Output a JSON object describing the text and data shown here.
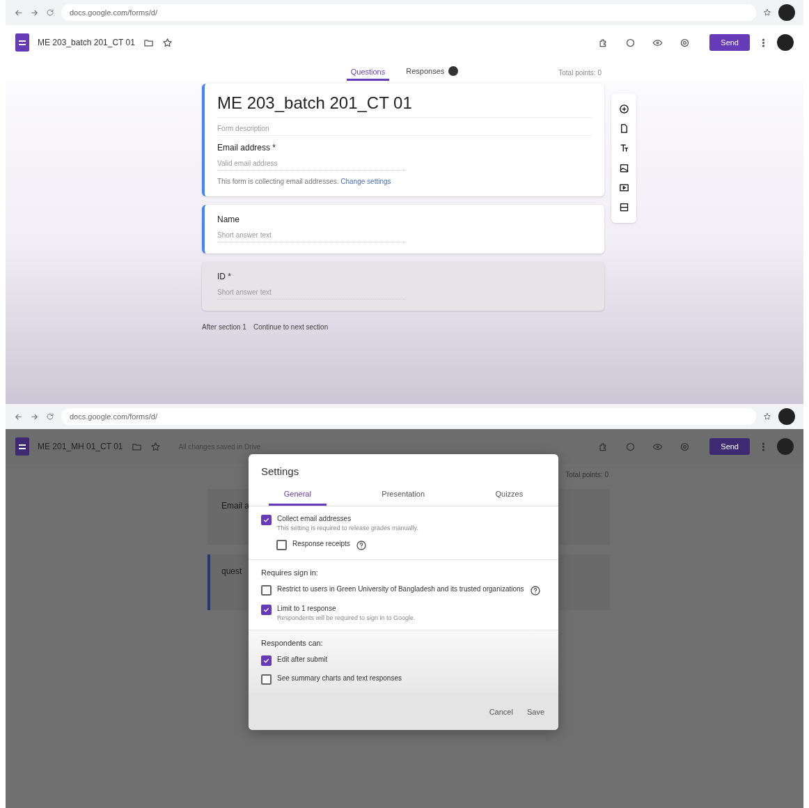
{
  "top_window": {
    "url": "docs.google.com/forms/d/",
    "doc_title": "ME 203_batch 201_CT 01",
    "tabs": [
      {
        "label": "Questions",
        "selected": true
      },
      {
        "label": "Responses",
        "selected": false
      }
    ],
    "total_points": "Total points: 0",
    "send_label": "Send",
    "form": {
      "title": "ME 203_batch 201_CT 01",
      "description_placeholder": "Form description",
      "questions": [
        {
          "label": "Email address *",
          "placeholder": "Valid email address",
          "note": "This form is collecting email addresses.",
          "note_link": "Change settings",
          "selected": true
        },
        {
          "label": "Name",
          "placeholder": "Short answer text",
          "selected": true
        },
        {
          "label": "ID *",
          "placeholder": "Short answer text",
          "selected": false
        }
      ],
      "after_section": "After section 1",
      "next_action": "Continue to next section"
    }
  },
  "bottom_window": {
    "url": "docs.google.com/forms/d/",
    "doc_title": "ME 201_MH 01_CT 01",
    "save_status": "All changes saved in Drive",
    "send_label": "Send",
    "total_points": "Total points: 0",
    "background_texts": [
      "Email a",
      "quest"
    ],
    "settings": {
      "title": "Settings",
      "tabs": [
        {
          "label": "General",
          "selected": true
        },
        {
          "label": "Presentation",
          "selected": false
        },
        {
          "label": "Quizzes",
          "selected": false
        }
      ],
      "sections": [
        {
          "items": [
            {
              "label": "Collect email addresses",
              "hint": "This setting is required to release grades manually.",
              "checked": true,
              "indent": false,
              "help": false
            },
            {
              "label": "Response receipts",
              "checked": false,
              "indent": true,
              "help": true
            }
          ]
        },
        {
          "heading": "Requires sign in:",
          "items": [
            {
              "label": "Restrict to users in Green University of Bangladesh and its trusted organizations",
              "checked": false,
              "indent": false,
              "help": true
            },
            {
              "label": "Limit to 1 response",
              "hint": "Respondents will be required to sign in to Google.",
              "checked": true,
              "indent": false,
              "help": false
            }
          ]
        },
        {
          "heading": "Respondents can:",
          "items": [
            {
              "label": "Edit after submit",
              "checked": true,
              "indent": false,
              "help": false
            },
            {
              "label": "See summary charts and text responses",
              "checked": false,
              "indent": false,
              "help": false
            }
          ]
        }
      ],
      "buttons": [
        "Cancel",
        "Save"
      ]
    }
  }
}
